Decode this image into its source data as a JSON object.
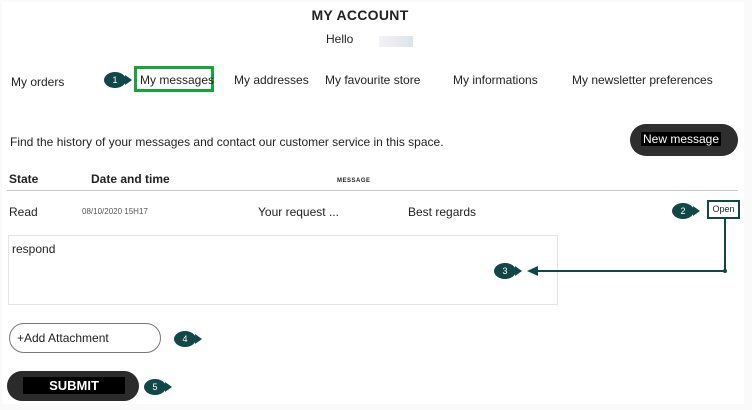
{
  "header": {
    "title": "MY ACCOUNT",
    "greeting": "Hello"
  },
  "tabs": [
    {
      "label": "My orders"
    },
    {
      "label": "My messages",
      "active": true
    },
    {
      "label": "My addresses"
    },
    {
      "label": "My favourite store"
    },
    {
      "label": "My informations"
    },
    {
      "label": "My newsletter preferences"
    }
  ],
  "intro": {
    "description": "Find the history of your messages and contact our customer service in this space.",
    "new_message_label": "New message"
  },
  "table": {
    "headers": {
      "state": "State",
      "date_time": "Date and time",
      "message": "MESSAGE"
    },
    "rows": [
      {
        "state": "Read",
        "date": "08/10/2020 15H17",
        "subject": "Your request ...",
        "preview": "Best regards",
        "action_label": "Open"
      }
    ]
  },
  "reply": {
    "text": "respond",
    "attachment_label": "+Add Attachment",
    "submit_label": "SUBMIT"
  },
  "callouts": [
    "1",
    "2",
    "3",
    "4",
    "5"
  ],
  "colors": {
    "highlight": "#17a43f",
    "callout": "#114747",
    "button_dark": "#2b2b2b"
  },
  "icons": {
    "callout": "numbered-pointer-badge",
    "connector": "arrow-line"
  }
}
